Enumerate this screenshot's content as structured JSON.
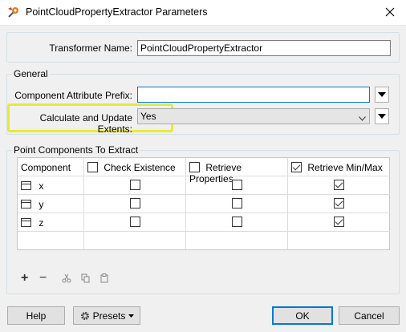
{
  "window": {
    "title": "PointCloudPropertyExtractor Parameters",
    "icon": "fme-transformer-icon",
    "close_icon": "close-icon"
  },
  "transformer": {
    "label": "Transformer Name:",
    "value": "PointCloudPropertyExtractor"
  },
  "general": {
    "group_label": "General",
    "prefix_label": "Component Attribute Prefix:",
    "prefix_value": "",
    "extents_label": "Calculate and Update Extents:",
    "extents_value": "Yes",
    "highlight_color": "#e5ea3a"
  },
  "components": {
    "group_label": "Point Components To Extract",
    "columns": [
      "Component",
      "Check Existence",
      "Retrieve Properties",
      "Retrieve Min/Max"
    ],
    "header_checks": [
      false,
      false,
      true
    ],
    "rows": [
      {
        "name": "x",
        "check_existence": false,
        "retrieve_properties": false,
        "retrieve_minmax": true
      },
      {
        "name": "y",
        "check_existence": false,
        "retrieve_properties": false,
        "retrieve_minmax": true
      },
      {
        "name": "z",
        "check_existence": false,
        "retrieve_properties": false,
        "retrieve_minmax": true
      }
    ],
    "toolbar": {
      "add": "+",
      "remove": "−",
      "cut_icon": "cut-icon",
      "copy_icon": "copy-icon",
      "paste_icon": "paste-icon"
    }
  },
  "footer": {
    "help": "Help",
    "presets": "Presets",
    "ok": "OK",
    "cancel": "Cancel"
  }
}
